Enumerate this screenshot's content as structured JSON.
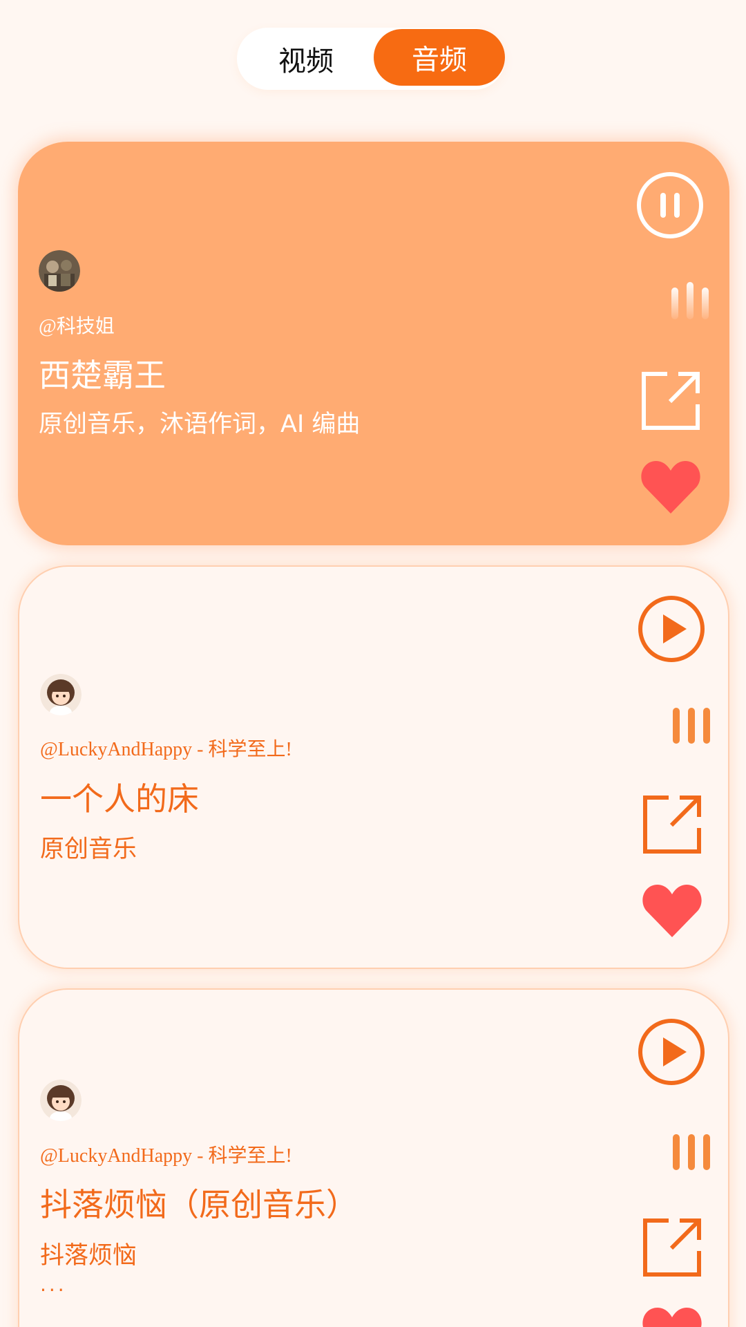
{
  "tabs": {
    "video_label": "视频",
    "audio_label": "音频",
    "active": "audio"
  },
  "colors": {
    "accent": "#f76b12",
    "active_card": "#ffab72",
    "heart": "#ff5353",
    "page_bg": "#fff7f2"
  },
  "cards": [
    {
      "author": "@科技姐",
      "title": "西楚霸王",
      "description": "原创音乐，沐语作词，AI 编曲",
      "state": "playing",
      "control_icon": "pause-icon",
      "avatar_icon": "avatar-photo-icon",
      "liked": true
    },
    {
      "author": "@LuckyAndHappy - 科学至上!",
      "title": "一个人的床",
      "description": "原创音乐",
      "state": "paused",
      "control_icon": "play-icon",
      "avatar_icon": "avatar-girl-icon",
      "liked": true
    },
    {
      "author": "@LuckyAndHappy - 科学至上!",
      "title": "抖落烦恼（原创音乐）",
      "description": "抖落烦恼",
      "more": "···",
      "state": "paused",
      "control_icon": "play-icon",
      "avatar_icon": "avatar-girl-icon",
      "liked": true
    }
  ]
}
